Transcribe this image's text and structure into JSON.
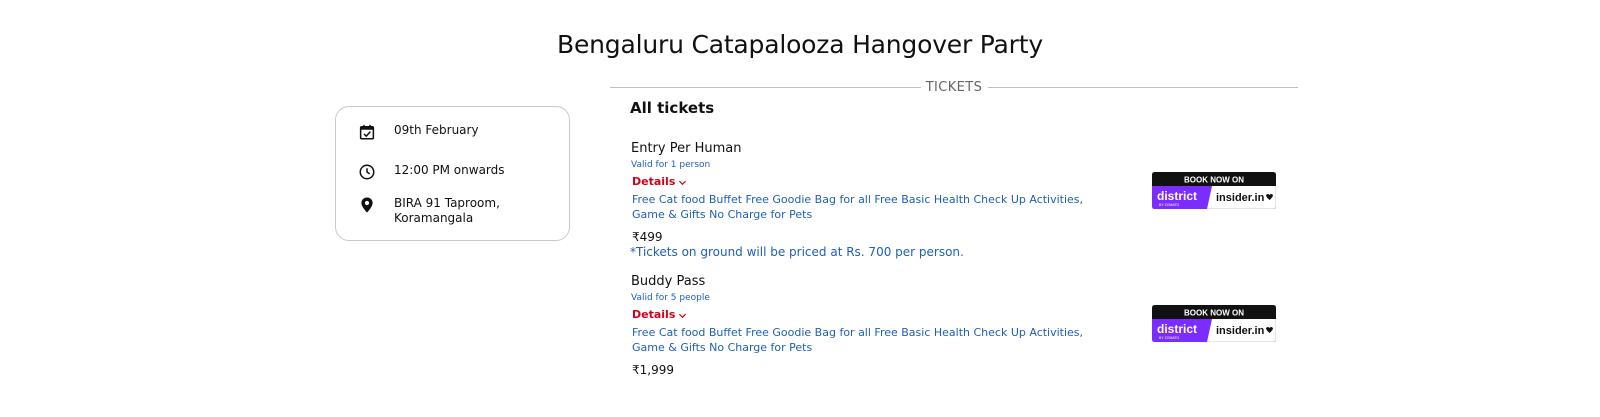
{
  "page": {
    "title": "Bengaluru Catapalooza Hangover Party"
  },
  "info_card": {
    "date": "09th February",
    "time": "12:00 PM onwards",
    "venue_line1": "BIRA 91 Taproom,",
    "venue_line2": "Koramangala",
    "icons": [
      "calendar-check-icon",
      "clock-icon",
      "location-pin-icon"
    ]
  },
  "tickets_section": {
    "divider_label": "TICKETS",
    "heading": "All tickets",
    "ground_note": "*Tickets on ground will be priced at Rs. 700 per person.",
    "items": [
      {
        "name": "Entry Per Human",
        "valid": "Valid for 1 person",
        "details_label": "Details",
        "description": "Free Cat food Buffet Free Goodie Bag for all Free Basic Health Check Up Activities, Game & Gifts No Charge for Pets",
        "price": "₹499",
        "book_top": "BOOK NOW ON",
        "book_left": "district",
        "book_left_sub": "BY ZOMATO",
        "book_right": "insider.in"
      },
      {
        "name": "Buddy Pass",
        "valid": "Valid for 5 people",
        "details_label": "Details",
        "description": "Free Cat food Buffet Free Goodie Bag for all Free Basic Health Check Up Activities, Game & Gifts No Charge for Pets",
        "price": "₹1,999",
        "book_top": "BOOK NOW ON",
        "book_left": "district",
        "book_left_sub": "BY ZOMATO",
        "book_right": "insider.in"
      }
    ]
  },
  "colors": {
    "link_blue": "#1e60b4",
    "details_red": "#d0021b",
    "district_purple": "#7b2cff",
    "card_border": "#c9c9c9"
  }
}
